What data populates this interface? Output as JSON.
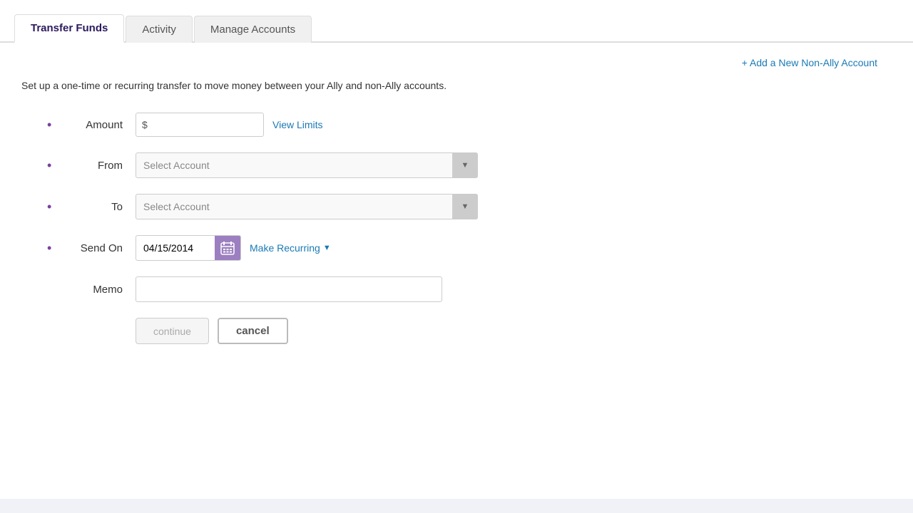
{
  "tabs": [
    {
      "id": "transfer-funds",
      "label": "Transfer Funds",
      "active": true
    },
    {
      "id": "activity",
      "label": "Activity",
      "active": false
    },
    {
      "id": "manage-accounts",
      "label": "Manage Accounts",
      "active": false
    }
  ],
  "header": {
    "add_account_label": "+ Add a New Non-Ally Account"
  },
  "description": "Set up a one-time or recurring transfer to move money between your Ally and non-Ally accounts.",
  "form": {
    "amount_label": "Amount",
    "amount_dollar_sign": "$",
    "amount_placeholder": "",
    "view_limits_label": "View Limits",
    "from_label": "From",
    "from_placeholder": "Select Account",
    "to_label": "To",
    "to_placeholder": "Select Account",
    "send_on_label": "Send On",
    "send_on_value": "04/15/2014",
    "make_recurring_label": "Make Recurring",
    "memo_label": "Memo",
    "memo_placeholder": "",
    "continue_label": "continue",
    "cancel_label": "cancel"
  }
}
